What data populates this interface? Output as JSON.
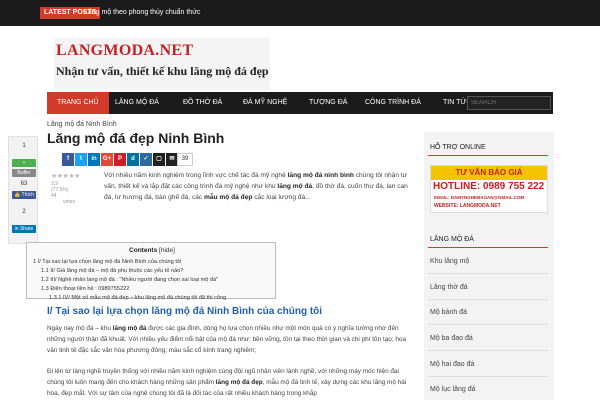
{
  "topbar": {
    "badge": "LATEST POSTS",
    "ticker": "Lăng mộ theo phong thủy chuẩn thức"
  },
  "header": {
    "logo_title": "LANGMODA.NET",
    "logo_subtitle": "Nhận tư vấn, thiết kế khu lăng mộ đá đẹp"
  },
  "nav": {
    "items": [
      "TRANG CHỦ",
      "LĂNG MỘ ĐÁ",
      "ĐỒ THỜ ĐÁ",
      "ĐÁ MỸ NGHỆ",
      "TƯỢNG ĐÁ",
      "CÔNG TRÌNH ĐÁ",
      "TIN TỨC"
    ],
    "search_placeholder": "SEARCH"
  },
  "share_panel": {
    "count1": "1",
    "buffer_label": "Buffer",
    "count2": "63",
    "like_label": "Thích",
    "count3": "2",
    "share_label": "Share"
  },
  "article": {
    "breadcrumb": "Lăng mộ đá Ninh Bình",
    "title": "Lăng mộ đá đẹp Ninh Bình",
    "share_count": "39",
    "rating_stars": "★★★★★",
    "rating_text1": "3.9 (77.5%) 44",
    "rating_text2": "votes",
    "intro_parts": [
      "Với nhiều năm kinh nghiệm trong lĩnh vực chế tác đá mỹ nghệ ",
      "lăng mộ đá ninh bình",
      " chúng tôi nhận tư vấn, thiết kế và lắp đặt các công trình đá mỹ nghệ như khu ",
      "lăng mộ đá",
      ", đồ thờ đá, cuốn thư đá, lan can đá, lư hương đá, bàn ghế đá, các ",
      "mẫu mộ đá đẹp",
      " cắc loại lượng đá..."
    ],
    "toc": {
      "title": "Contents",
      "hide": "[hide]",
      "items": [
        "1 I/ Tại sao lại lựa chọn lăng mộ đá Ninh Bình của chúng tôi",
        "1.1 II/ Giá lăng mộ đá – mộ đá phụ thuộc các yếu tố nào?",
        "1.2 III/ Nghệ nhân làng mộ đá : \"Nhiều người đang chọn sai loại mộ đá\"",
        "1.3 Điện thoại liên hệ : 0989755222",
        "1.3.1 IV/ Một số mẫu mộ đá đẹp – khu lăng mộ đá chúng tôi đã thi công"
      ]
    },
    "h2": "I/ Tại sao lại lựa chọn lăng mộ đá Ninh Bình của chúng tôi",
    "para1_parts": [
      "Ngày nay mộ đá – khu ",
      "lăng mộ đá",
      " được các gia đình, dòng họ lựa chọn nhiều như một món quà có ý nghĩa tưởng nhớ đến những người thân đã khuất. Với nhiều yếu điểm nổi bật của mộ đá như: bền vững, tồn tại theo thời gian và chi phí tồn tạo; hoa văn tinh tế đặc sắc văn hóa phương đông; màu sắc cổ kính trang nghiêm;"
    ],
    "para2_parts": [
      "Đi lên từ làng nghề truyền thống với nhiều năm kinh nghiệm cùng đội ngũ nhân viên lành nghề, với những máy móc hiện đại chúng tôi luôn mang đến cho khách hàng những sản phẩm ",
      "lăng mộ đá đẹp",
      ", mẫu mộ đá tinh tế, xây dựng các khu lăng mộ hài hòa, đẹp mắt. Với sự tâm của nghệ chúng tôi đã là đối tác của rất nhiều khách hàng trong khắp"
    ]
  },
  "sidebar": {
    "support_title": "HỖ TRỢ ONLINE",
    "banner_head": "TƯ VẤN BÁO GIÁ",
    "banner_hotline": "HOTLINE: 0989 755 222",
    "banner_email": "EMAIL: DAMYNGHEBAOAN@GMAIL.COM",
    "banner_site": "WEBSITE: LANGMODA.NET",
    "category_title": "LĂNG MỘ ĐÁ",
    "links": [
      "Khu lăng mộ",
      "Lăng thờ đá",
      "Mộ bành đá",
      "Mộ ba đao đá",
      "Mộ hai đao đá",
      "Mộ lục lăng đá"
    ]
  },
  "colors": {
    "accent": "#d23a2a",
    "heading_blue": "#1f5fb0",
    "topbar": "#1b1b1b"
  }
}
